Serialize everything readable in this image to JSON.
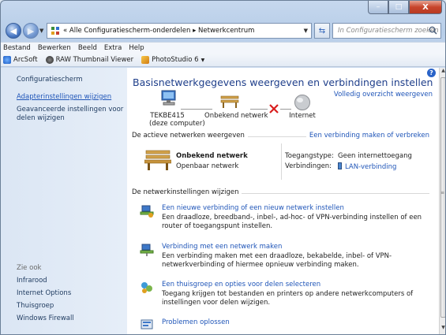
{
  "window": {
    "minimize_glyph": "–",
    "maximize_glyph": "□",
    "close_glyph": "X"
  },
  "nav": {
    "address_path": "«  Alle Configuratiescherm-onderdelen  ▸  Netwerkcentrum",
    "search_placeholder": "In Configuratiescherm zoeken"
  },
  "menubar": {
    "items": [
      {
        "label": "Bestand"
      },
      {
        "label": "Bewerken"
      },
      {
        "label": "Beeld"
      },
      {
        "label": "Extra"
      },
      {
        "label": "Help"
      }
    ]
  },
  "toolbar": {
    "items": [
      {
        "label": "ArcSoft",
        "icon": "arcsoft-icon"
      },
      {
        "label": "RAW Thumbnail Viewer",
        "icon": "camera-icon"
      },
      {
        "label": "PhotoStudio 6",
        "icon": "photostudio-icon"
      }
    ]
  },
  "left": {
    "home": "Configuratiescherm",
    "adapter": "Adapterinstellingen wijzigen",
    "sharing_1": "Geavanceerde instellingen voor",
    "sharing_2": "delen wijzigen",
    "see_also": "Zie ook",
    "see_links": [
      "Infrarood",
      "Internet Options",
      "Thuisgroep",
      "Windows Firewall"
    ]
  },
  "main": {
    "title": "Basisnetwerkgegevens weergeven en verbindingen instellen",
    "full_map": "Volledig overzicht weergeven",
    "map": {
      "computer_name": "TEKBE415",
      "computer_sub": "(deze computer)",
      "network": "Onbekend netwerk",
      "internet": "Internet"
    },
    "active_title": "De actieve netwerken weergeven",
    "connect_link": "Een verbinding maken of verbreken",
    "network": {
      "name": "Onbekend netwerk",
      "type": "Openbaar netwerk",
      "access_label": "Toegangstype:",
      "access_value": "Geen internettoegang",
      "conn_label": "Verbindingen:",
      "conn_value": "LAN-verbinding"
    },
    "change_title": "De netwerkinstellingen wijzigen",
    "tasks": [
      {
        "icon": "network-setup-icon",
        "link": "Een nieuwe verbinding of een nieuw netwerk instellen",
        "desc": "Een draadloze, breedband-, inbel-, ad-hoc- of VPN-verbinding instellen of een router of toegangspunt instellen."
      },
      {
        "icon": "network-connect-icon",
        "link": "Verbinding met een netwerk maken",
        "desc": "Een verbinding maken met een draadloze, bekabelde, inbel- of VPN-netwerkverbinding of hiermee opnieuw verbinding maken."
      },
      {
        "icon": "homegroup-icon",
        "link": "Een thuisgroep en opties voor delen selecteren",
        "desc": "Toegang krijgen tot bestanden en printers op andere netwerkcomputers of instellingen voor delen wijzigen."
      },
      {
        "icon": "troubleshoot-icon",
        "link": "Problemen oplossen",
        "desc": ""
      }
    ]
  },
  "colors": {
    "link": "#1f55b8",
    "title": "#1e3e8a",
    "left_pane": "#dbe6f4"
  }
}
